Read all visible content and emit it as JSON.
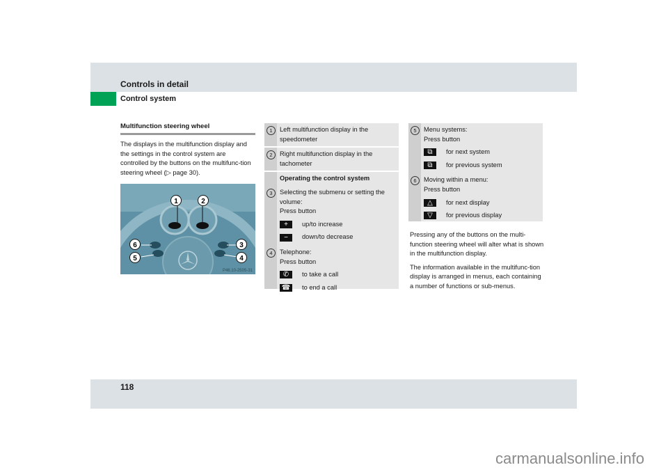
{
  "header": {
    "title": "Controls in detail",
    "subtitle": "Control system",
    "accent_color": "#00a356"
  },
  "section": {
    "heading": "Multifunction steering wheel",
    "intro": "The displays in the multifunction display and the settings in the control system are controlled by the buttons on the multifunc-tion steering wheel (▷ page 30).",
    "figure": {
      "code": "P46.10-2505-31",
      "callouts": [
        "1",
        "2",
        "3",
        "4",
        "5",
        "6"
      ]
    }
  },
  "legend_a": [
    {
      "num": "1",
      "text": "Left multifunction display in the speedometer"
    },
    {
      "num": "2",
      "text": "Right multifunction display in the tachometer"
    },
    {
      "heading": "Operating the control system"
    },
    {
      "num": "3",
      "text": "Selecting the submenu or setting the volume:",
      "sub": "Press button",
      "buttons": [
        {
          "icon": "plus-icon",
          "glyph": "+",
          "label": "up/to increase"
        },
        {
          "icon": "minus-icon",
          "glyph": "−",
          "label": "down/to decrease"
        }
      ]
    },
    {
      "num": "4",
      "text": "Telephone:",
      "sub": "Press button",
      "buttons": [
        {
          "icon": "phone-pickup-icon",
          "glyph": "✆",
          "label": "to take a call"
        },
        {
          "icon": "phone-hangup-icon",
          "glyph": "☎",
          "label": "to end a call"
        }
      ]
    }
  ],
  "legend_b": [
    {
      "num": "5",
      "text": "Menu systems:",
      "sub": "Press button",
      "buttons": [
        {
          "icon": "next-system-icon",
          "glyph": "⧉",
          "label": "for next system"
        },
        {
          "icon": "previous-system-icon",
          "glyph": "⧉",
          "label": "for previous system"
        }
      ]
    },
    {
      "num": "6",
      "text": "Moving within a menu:",
      "sub": "Press button",
      "buttons": [
        {
          "icon": "up-arrow-icon",
          "glyph": "△",
          "label": "for next display"
        },
        {
          "icon": "down-arrow-icon",
          "glyph": "▽",
          "label": "for previous display"
        }
      ]
    }
  ],
  "body_text": [
    "Pressing any of the buttons on the multi-function steering wheel will alter what is shown in the multifunction display.",
    "The information available in the multifunc-tion display is arranged in menus, each containing a number of functions or sub-menus."
  ],
  "footer": {
    "page_number": "118"
  },
  "watermark": "carmanualsonline.info"
}
